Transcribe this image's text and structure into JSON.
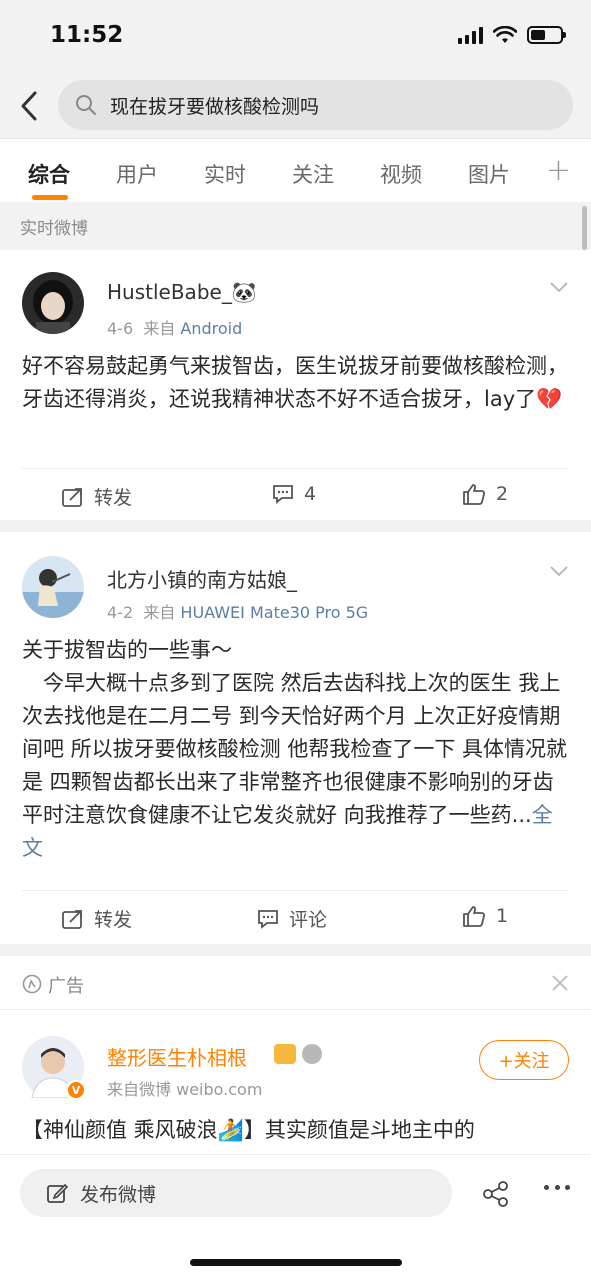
{
  "status_bar": {
    "time": "11:52",
    "battery_level": 0.5
  },
  "search": {
    "query": "现在拔牙要做核酸检测吗"
  },
  "tabs": [
    {
      "label": "综合",
      "active": true
    },
    {
      "label": "用户"
    },
    {
      "label": "实时"
    },
    {
      "label": "关注"
    },
    {
      "label": "视频"
    },
    {
      "label": "图片"
    }
  ],
  "tab_add_label": "+",
  "section_label": "实时微博",
  "posts": [
    {
      "username": "HustleBabe_🐼",
      "date": "4-6",
      "source_prefix": "来自",
      "source": "Android",
      "text": "好不容易鼓起勇气来拔智齿，医生说拔牙前要做核酸检测，牙齿还得消炎，还说我精神状态不好不适合拔牙，lay了💔",
      "repost_label": "转发",
      "comment_label": "4",
      "like_label": "2"
    },
    {
      "username": "北方小镇的南方姑娘_",
      "date": "4-2",
      "source_prefix": "来自",
      "source": "HUAWEI Mate30 Pro 5G",
      "text_title": "关于拔智齿的一些事～",
      "text": "　今早大概十点多到了医院 然后去齿科找上次的医生 我上次去找他是在二月二号 到今天恰好两个月 上次正好疫情期间吧 所以拔牙要做核酸检测 他帮我检查了一下 具体情况就是 四颗智齿都长出来了非常整齐也很健康不影响别的牙齿 平时注意饮食健康不让它发炎就好 向我推荐了一些药...",
      "full_text_link": "全文",
      "repost_label": "转发",
      "comment_label": "评论",
      "like_label": "1"
    }
  ],
  "ad": {
    "label": "广告",
    "username": "整形医生朴相根",
    "source_prefix": "来自微博",
    "source": "weibo.com",
    "follow_label": "+关注",
    "text": "【神仙颜值 乘风破浪🏄】其实颜值是斗地主中的"
  },
  "bottom_bar": {
    "compose_label": "发布微博"
  },
  "colors": {
    "accent": "#ff8200",
    "link": "#5b7ea6",
    "background": "#f2f2f2"
  }
}
